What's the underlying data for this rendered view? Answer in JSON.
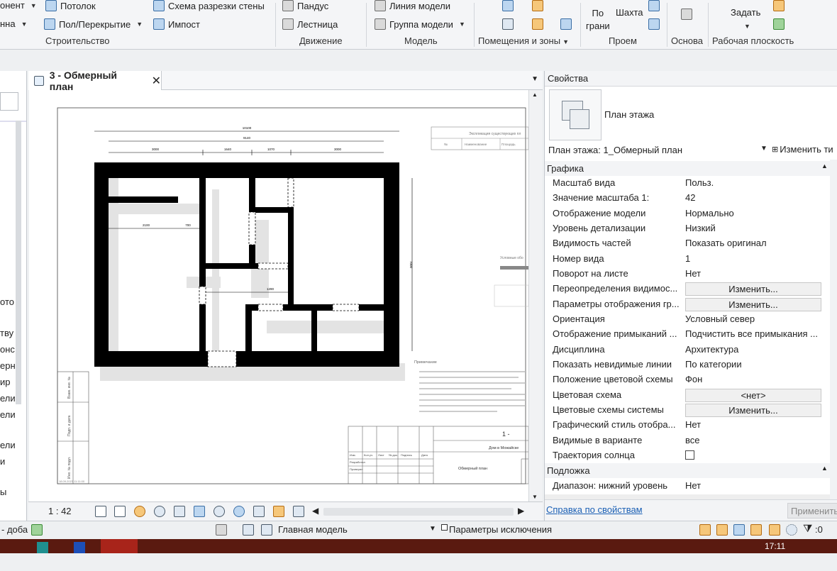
{
  "ribbon": {
    "items": {
      "component": "онент",
      "ceiling": "Потолок",
      "wall_cut": "Схема разрезки стены",
      "ramp": "Пандус",
      "model_line": "Линия  модели",
      "floor": "Пол/Перекрытие",
      "mullion": "Импост",
      "stairs": "Лестница",
      "model_group": "Группа модели",
      "nna": "нна",
      "by_face": "По\nграни",
      "shaft": "Шахта",
      "set": "Задать"
    },
    "groups": {
      "build": "Строительство",
      "circulation": "Движение",
      "model": "Модель",
      "rooms": "Помещения и зоны",
      "opening": "Проем",
      "datum": "Основа",
      "work_plane": "Рабочая плоскость"
    }
  },
  "view": {
    "tab_title": "3 - Обмерный план",
    "scale": "1 : 42"
  },
  "drawing": {
    "dims": {
      "total": "10100",
      "d1": "9140",
      "s1": "3000",
      "s2": "1640",
      "s3": "1070",
      "s4": "3000",
      "inner1": "2100",
      "inner2": "700",
      "inner3": "1290",
      "vert": "7000"
    },
    "legend_title": "Экспликация существующих пл",
    "legend_cols": [
      "№",
      "Наименование",
      "Площадь"
    ],
    "notes_title": "Примечание",
    "symbols_title": "Условные обо",
    "stamp_sheet": "1 -",
    "stamp_project": "Дом в Можайске",
    "stamp_view": "Обмерный план",
    "stamp_rows": [
      "Разработал",
      "Проверил"
    ],
    "stamp_heads": [
      "Изм.",
      "Кол.уч.",
      "Лист",
      "№ док.",
      "Подпись",
      "Дата"
    ],
    "side_labels": [
      "Взам. инв. №",
      "Подп. и дата",
      "Инв. № подл."
    ],
    "date_footer": "18.09.2023 11:11:00"
  },
  "properties": {
    "panel_title": "Свойства",
    "type_name": "План этажа",
    "selector_value": "План этажа: 1_Обмерный план",
    "edit_type": "Изменить ти",
    "category_graphics": "Графика",
    "category_underlay": "Подложка",
    "rows": [
      {
        "key": "Масштаб вида",
        "value": "Польз."
      },
      {
        "key": "Значение масштаба    1:",
        "value": "42"
      },
      {
        "key": "Отображение модели",
        "value": "Нормально"
      },
      {
        "key": "Уровень детализации",
        "value": "Низкий"
      },
      {
        "key": "Видимость частей",
        "value": "Показать оригинал"
      },
      {
        "key": "Номер вида",
        "value": "1"
      },
      {
        "key": "Поворот на листе",
        "value": "Нет"
      },
      {
        "key": "Переопределения видимос...",
        "value": "Изменить..."
      },
      {
        "key": "Параметры отображения гр...",
        "value": "Изменить..."
      },
      {
        "key": "Ориентация",
        "value": "Условный север"
      },
      {
        "key": "Отображение примыканий ...",
        "value": "Подчистить все примыкания ..."
      },
      {
        "key": "Дисциплина",
        "value": "Архитектура"
      },
      {
        "key": "Показать невидимые линии",
        "value": "По категории"
      },
      {
        "key": "Положение цветовой схемы",
        "value": "Фон"
      },
      {
        "key": "Цветовая схема",
        "value": "<нет>"
      },
      {
        "key": "Цветовые схемы системы",
        "value": "Изменить..."
      },
      {
        "key": "Графический стиль отобра...",
        "value": "Нет"
      },
      {
        "key": "Видимые в варианте",
        "value": "все"
      },
      {
        "key": "Траектория солнца",
        "value": ""
      }
    ],
    "underlay_rows": [
      {
        "key": "Диапазон: нижний уровень",
        "value": "Нет"
      }
    ],
    "help_link": "Справка по свойствам",
    "apply": "Применить"
  },
  "status": {
    "left": "- доба",
    "model": "Главная модель",
    "exclude": "Параметры исключения",
    "filter_count": ":0",
    "clock": "17:11"
  },
  "left_strip_labels": [
    "ото",
    "тву",
    "онс",
    "ерн",
    "ир",
    "ели",
    "ели",
    "ели",
    "и",
    "ы"
  ],
  "colors": {
    "annotation_red": "#c4161c",
    "wall": "#000000",
    "shadow": "#e2e2e2"
  }
}
